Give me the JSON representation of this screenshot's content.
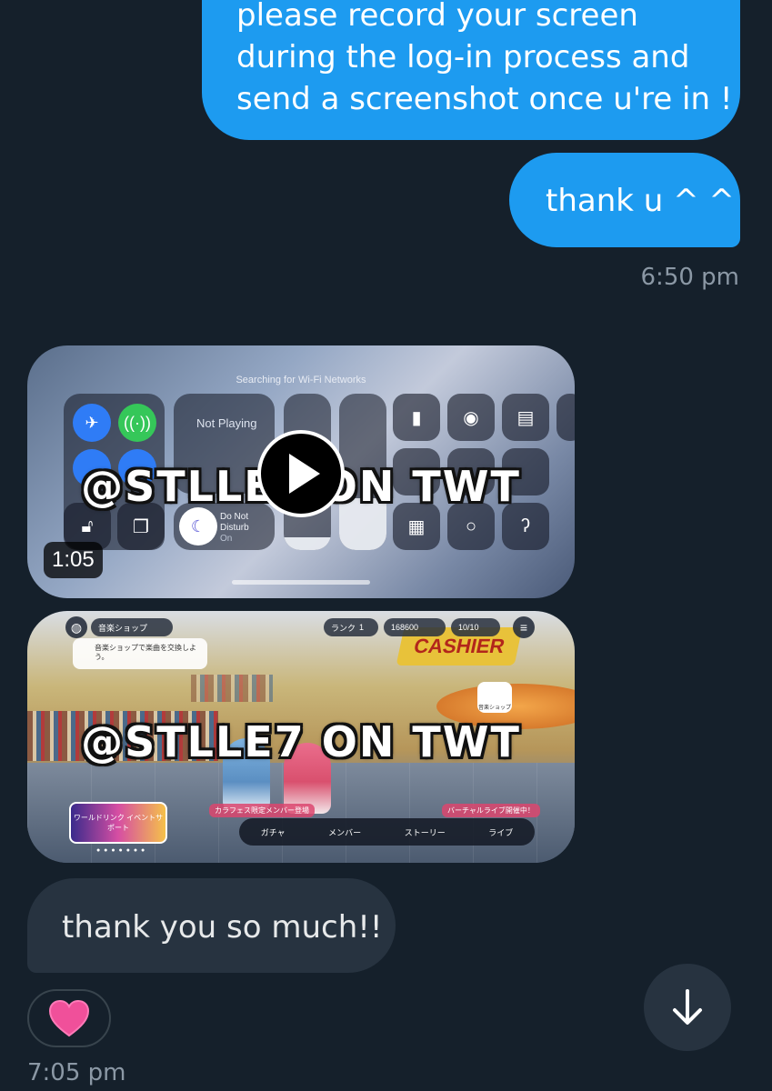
{
  "messages": {
    "sent_1": {
      "lines": [
        "please record your screen",
        "during the log-in process and",
        "send a screenshot once u're in !"
      ]
    },
    "sent_2": {
      "text": "thank u ^ ^"
    },
    "time_1": "6:50 pm",
    "video": {
      "duration": "1:05",
      "watermark": "@STLLE7 ON TWT",
      "screen": {
        "wifi_status": "Searching for Wi-Fi Networks",
        "now_playing": "Not Playing",
        "dnd_line1": "Do Not",
        "dnd_line2": "Disturb",
        "dnd_state": "On"
      }
    },
    "image": {
      "watermark": "@STLLE7 ON TWT",
      "game": {
        "location": "音楽ショップ",
        "rank_label": "ランク",
        "rank_value": "1",
        "currency": "168600",
        "stamina": "10/10",
        "message": "音楽ショップで楽曲を交換しよう。",
        "sign": "CASHIER",
        "shop_label": "音楽ショップ",
        "banner_left": "カラフェス限定メンバー登場",
        "banner_right": "バーチャルライブ開催中！",
        "event_banner": "ワールドリンク イベントサポート",
        "nav": [
          "ガチャ",
          "メンバー",
          "ストーリー",
          "ライブ"
        ]
      }
    },
    "received_1": {
      "text": "thank you so much!!"
    },
    "reaction": "heart",
    "time_2": "7:05 pm"
  },
  "colors": {
    "background": "#15202b",
    "sent_bubble": "#1d9bf0",
    "received_bubble": "#273340",
    "timestamp": "#8b98a5",
    "heart": "#f0509a"
  },
  "icons": [
    "airplane-icon",
    "cellular-icon",
    "flashlight-icon",
    "camera-icon",
    "note-add-icon",
    "rotation-lock-icon",
    "screen-mirror-icon",
    "moon-icon",
    "brightness-icon",
    "volume-icon",
    "calculator-icon",
    "record-icon",
    "hearing-icon",
    "play-icon",
    "heart-icon",
    "arrow-down-icon"
  ]
}
